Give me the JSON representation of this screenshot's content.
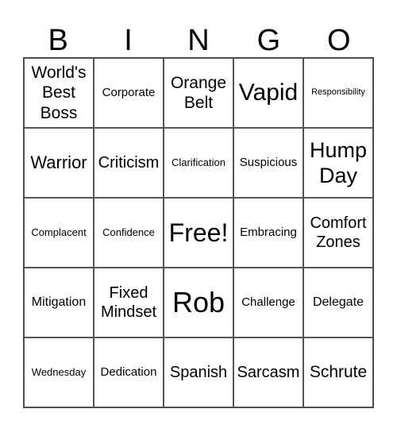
{
  "header": {
    "letters": [
      "B",
      "I",
      "N",
      "G",
      "O"
    ]
  },
  "cells": [
    [
      "World's Best Boss",
      "Corporate",
      "Orange Belt",
      "Vapid",
      "Responsibility"
    ],
    [
      "Warrior",
      "Criticism",
      "Clarification",
      "Suspicious",
      "Hump Day"
    ],
    [
      "Complacent",
      "Confidence",
      "Free!",
      "Embracing",
      "Comfort Zones"
    ],
    [
      "Mitigation",
      "Fixed Mindset",
      "Rob",
      "Challenge",
      "Delegate"
    ],
    [
      "Wednesday",
      "Dedication",
      "Spanish",
      "Sarcasm",
      "Schrute"
    ]
  ]
}
